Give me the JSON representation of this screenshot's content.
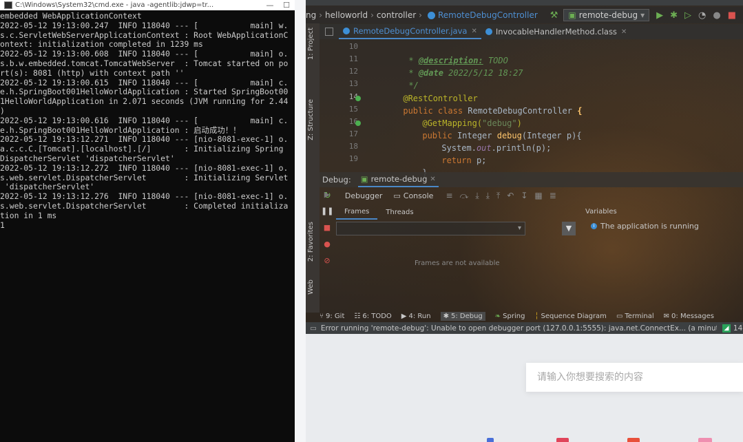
{
  "cmd": {
    "title": "C:\\Windows\\System32\\cmd.exe - java  -agentlib:jdwp=tr...",
    "lines": [
      "embedded WebApplicationContext",
      "2022-05-12 19:13:00.247  INFO 118040 --- [           main] w.",
      "s.c.ServletWebServerApplicationContext : Root WebApplicationC",
      "ontext: initialization completed in 1239 ms",
      "2022-05-12 19:13:00.608  INFO 118040 --- [           main] o.",
      "s.b.w.embedded.tomcat.TomcatWebServer  : Tomcat started on po",
      "rt(s): 8081 (http) with context path ''",
      "2022-05-12 19:13:00.615  INFO 118040 --- [           main] c.",
      "e.h.SpringBoot001HelloWorldApplication : Started SpringBoot00",
      "1HelloWorldApplication in 2.071 seconds (JVM running for 2.44",
      ")",
      "2022-05-12 19:13:00.616  INFO 118040 --- [           main] c.",
      "e.h.SpringBoot001HelloWorldApplication : 启动成功！！",
      "2022-05-12 19:13:12.271  INFO 118040 --- [nio-8081-exec-1] o.",
      "a.c.c.C.[Tomcat].[localhost].[/]       : Initializing Spring",
      "DispatcherServlet 'dispatcherServlet'",
      "2022-05-12 19:13:12.272  INFO 118040 --- [nio-8081-exec-1] o.",
      "s.web.servlet.DispatcherServlet        : Initializing Servlet",
      " 'dispatcherServlet'",
      "2022-05-12 19:13:12.276  INFO 118040 --- [nio-8081-exec-1] o.",
      "s.web.servlet.DispatcherServlet        : Completed initializa",
      "tion in 1 ms",
      "1"
    ]
  },
  "ide": {
    "breadcrumbs": [
      "ng",
      "helloworld",
      "controller",
      "RemoteDebugController"
    ],
    "run_config": "remote-debug",
    "tabs": [
      {
        "label": "RemoteDebugController.java",
        "active": true
      },
      {
        "label": "InvocableHandlerMethod.class",
        "active": false
      }
    ],
    "side_tabs": [
      "1: Project",
      "Z: Structure",
      "2: Favorites",
      "Web"
    ],
    "line_numbers": [
      "10",
      "11",
      "12",
      "13",
      "14",
      "15",
      "16",
      "17",
      "18",
      "19"
    ],
    "code": {
      "l10_tag": "@description:",
      "l10_text": " TODO",
      "l11_tag": "@date",
      "l11_text": " 2022/5/12 18:27",
      "l12": "*/",
      "l14_ann": "@RestController",
      "l15_kw": "public class ",
      "l15_name": "RemoteDebugController ",
      "l15_brace": "{",
      "l16_ann": "@GetMapping(",
      "l16_str": "\"debug\"",
      "l16_close": ")",
      "l17_kw": "public ",
      "l17_type": "Integer ",
      "l17_name": "debug",
      "l17_rest": "(Integer p){",
      "l18_a": "System.",
      "l18_field": "out",
      "l18_b": ".println(p);",
      "l19_kw": "return ",
      "l19_rest": "p;",
      "l20": "}"
    },
    "debug_label": "Debug:",
    "debug_session": "remote-debug",
    "debugger_tab": "Debugger",
    "console_tab": "Console",
    "frames_tab": "Frames",
    "threads_tab": "Threads",
    "variables_title": "Variables",
    "variables_message": "The application is running",
    "frames_empty": "Frames are not available",
    "bottom_tools": [
      {
        "label": "9: Git"
      },
      {
        "label": "6: TODO"
      },
      {
        "label": "4: Run"
      },
      {
        "label": "5: Debug",
        "active": true
      },
      {
        "label": "Spring"
      },
      {
        "label": "Sequence Diagram"
      },
      {
        "label": "Terminal"
      },
      {
        "label": "0: Messages"
      }
    ],
    "status": "Error running 'remote-debug': Unable to open debugger port (127.0.0.1:5555): java.net.ConnectEx... (a minute ago)",
    "status_right": "14"
  },
  "search": {
    "placeholder": "请输入你想要搜索的内容"
  },
  "colors": {
    "accent_blue": "#4a88c7",
    "run_green": "#6cae53",
    "stop_red": "#d9534f"
  }
}
